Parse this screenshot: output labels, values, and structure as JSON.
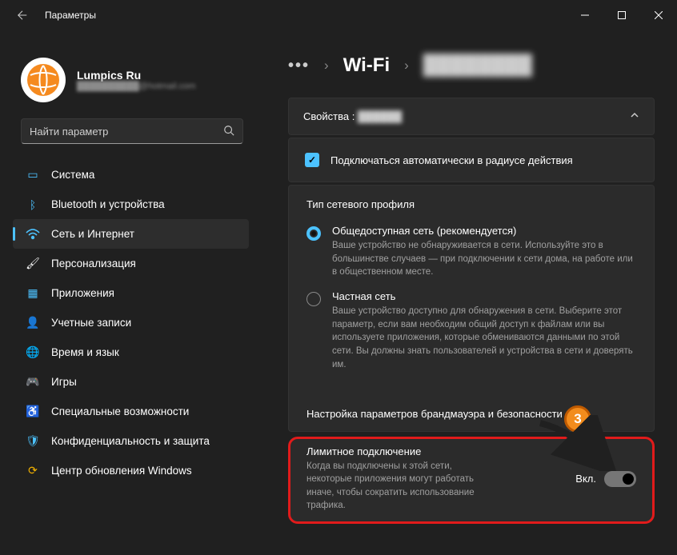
{
  "window": {
    "title": "Параметры"
  },
  "user": {
    "name": "Lumpics Ru",
    "email": "██████████@hotmail.com"
  },
  "search": {
    "placeholder": "Найти параметр"
  },
  "sidebar": {
    "items": [
      {
        "label": "Система"
      },
      {
        "label": "Bluetooth и устройства"
      },
      {
        "label": "Сеть и Интернет"
      },
      {
        "label": "Персонализация"
      },
      {
        "label": "Приложения"
      },
      {
        "label": "Учетные записи"
      },
      {
        "label": "Время и язык"
      },
      {
        "label": "Игры"
      },
      {
        "label": "Специальные возможности"
      },
      {
        "label": "Конфиденциальность и защита"
      },
      {
        "label": "Центр обновления Windows"
      }
    ]
  },
  "breadcrumb": {
    "wifi": "Wi-Fi",
    "network": "████████"
  },
  "props": {
    "label": "Свойства :",
    "value": "██████"
  },
  "autoconnect": {
    "label": "Подключаться автоматически в радиусе действия"
  },
  "profile": {
    "title": "Тип сетевого профиля",
    "public": {
      "label": "Общедоступная сеть (рекомендуется)",
      "desc": "Ваше устройство не обнаруживается в сети. Используйте это в большинстве случаев — при подключении к сети дома, на работе или в общественном месте."
    },
    "private": {
      "label": "Частная сеть",
      "desc": "Ваше устройство доступно для обнаружения в сети. Выберите этот параметр, если вам необходим общий доступ к файлам или вы используете приложения, которые обмениваются данными по этой сети. Вы должны знать пользователей и устройства в сети и доверять им."
    },
    "firewall": "Настройка параметров брандмауэра и безопасности"
  },
  "metered": {
    "title": "Лимитное подключение",
    "desc": "Когда вы подключены к этой сети, некоторые приложения могут работать иначе, чтобы сократить использование трафика.",
    "state": "Вкл."
  },
  "annotation": {
    "step": "3"
  }
}
